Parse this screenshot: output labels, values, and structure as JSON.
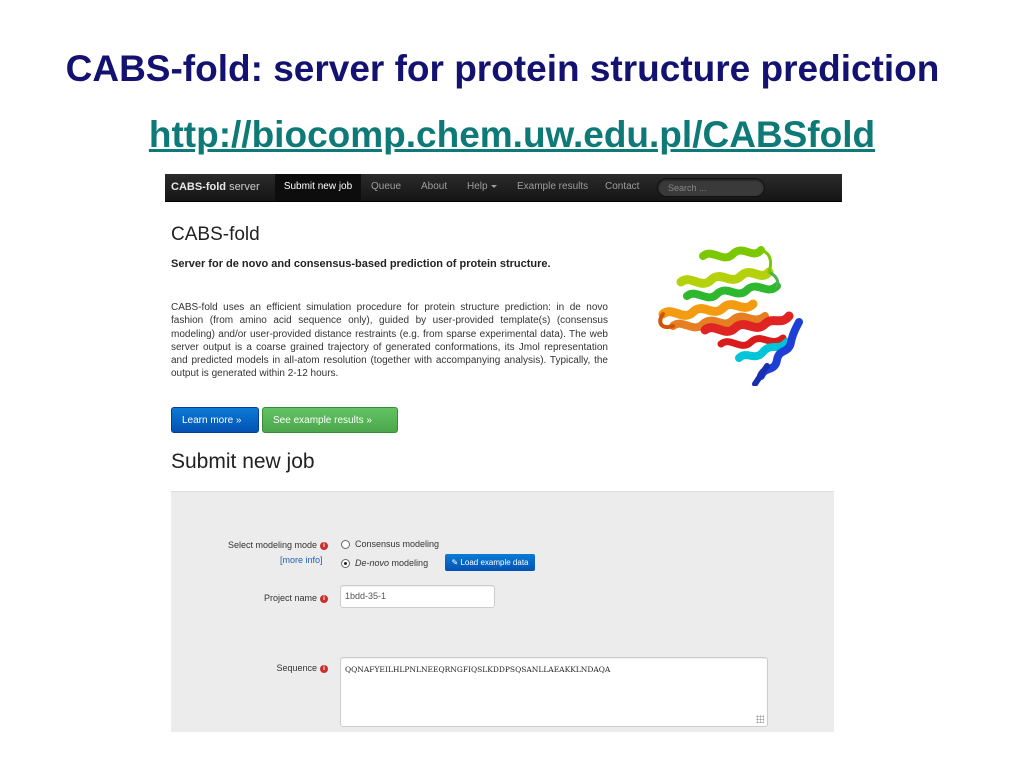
{
  "slide": {
    "title": "CABS-fold: server for protein structure prediction",
    "url": "http://biocomp.chem.uw.edu.pl/CABSfold"
  },
  "navbar": {
    "brand_bold": "CABS-fold",
    "brand_rest": "server",
    "items": [
      {
        "label": "Submit new job",
        "active": true
      },
      {
        "label": "Queue"
      },
      {
        "label": "About"
      },
      {
        "label": "Help"
      },
      {
        "label": "Example results"
      },
      {
        "label": "Contact"
      }
    ],
    "search_placeholder": "Search ..."
  },
  "hero": {
    "title": "CABS-fold",
    "subtitle": "Server for de novo and consensus-based prediction of protein structure.",
    "description": "CABS-fold uses an efficient simulation procedure for protein structure prediction: in de novo fashion (from amino acid sequence only), guided by user-provided template(s) (consensus modeling) and/or user-provided distance restraints (e.g. from sparse experimental data). The web server output is a coarse grained trajectory of generated conformations, its Jmol representation and predicted models in all-atom resolution (together with accompanying analysis). Typically, the output is generated within 2-12 hours.",
    "learn_more": "Learn more »",
    "see_examples": "See example results »"
  },
  "form": {
    "section_title": "Submit new job",
    "mode_label": "Select modeling mode",
    "more_info": "[more info]",
    "mode_options": [
      "Consensus modeling",
      "De-novo",
      "modeling"
    ],
    "selected_mode": "De-novo modeling",
    "load_example": "Load example data",
    "project_label": "Project name",
    "project_value": "1bdd-35-1",
    "sequence_label": "Sequence",
    "sequence_value": "QQNAFYEILHLPNLNEEQRNGFIQSLKDDPSQSANLLAEAKKLNDAQA",
    "info_glyph": "i"
  },
  "colors": {
    "title": "#141270",
    "url": "#0e7a78",
    "primary_button": "#0451b3",
    "success_button": "#4ca64c",
    "info_icon": "#c9302c"
  },
  "image": {
    "description": "protein-ribbon-rainbow-structure"
  }
}
